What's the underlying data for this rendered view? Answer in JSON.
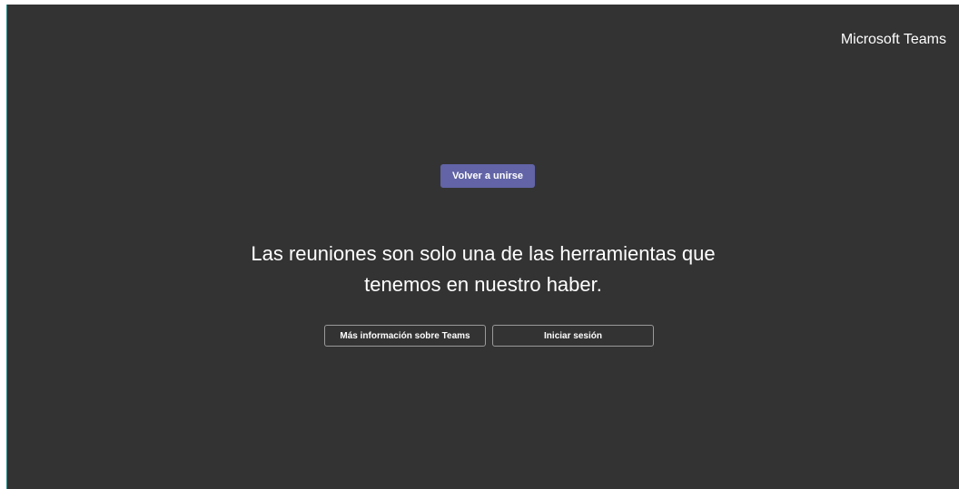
{
  "header": {
    "brand": "Microsoft Teams"
  },
  "main": {
    "rejoin_label": "Volver a unirse",
    "message_line1": "Las reuniones son solo una de las herramientas que",
    "message_line2": "tenemos en nuestro haber.",
    "learn_more_label": "Más información sobre Teams",
    "sign_in_label": "Iniciar sesión"
  },
  "colors": {
    "background": "#333333",
    "accent": "#6264a7",
    "text": "#ffffff"
  }
}
